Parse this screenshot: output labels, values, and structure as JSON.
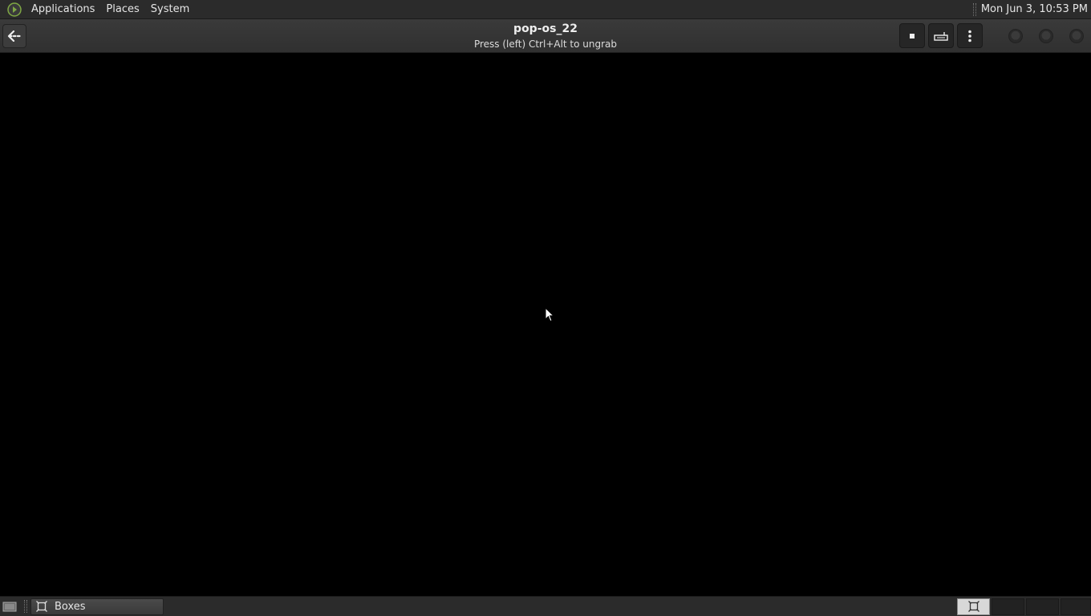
{
  "top_panel": {
    "menus": [
      "Applications",
      "Places",
      "System"
    ],
    "clock": "Mon Jun  3, 10:53 PM"
  },
  "header": {
    "title": "pop-os_22",
    "subtitle": "Press (left) Ctrl+Alt to ungrab"
  },
  "taskbar": {
    "window_label": "Boxes"
  },
  "colors": {
    "panel": "#2b2b2b",
    "header": "#333333",
    "display": "#000000",
    "logo_green": "#7fa844"
  }
}
